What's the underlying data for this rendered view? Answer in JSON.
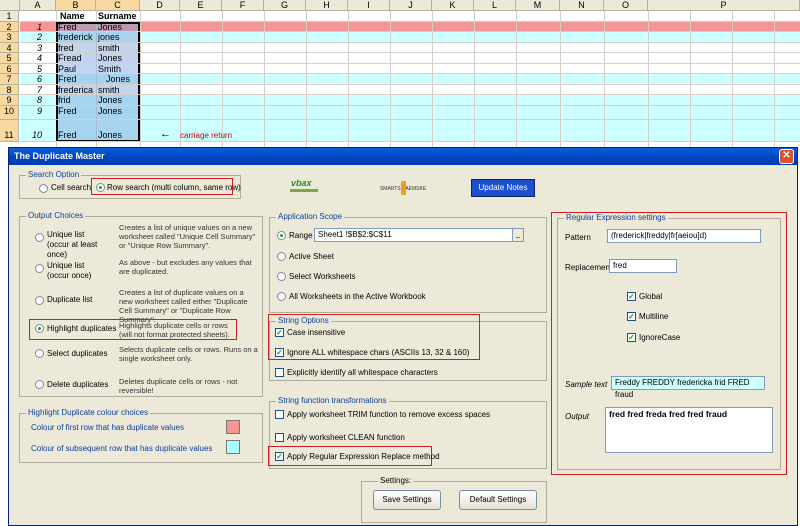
{
  "sheet": {
    "columns": [
      "A",
      "B",
      "C",
      "D",
      "E",
      "F",
      "G",
      "H",
      "I",
      "J",
      "K",
      "L",
      "M",
      "N",
      "O",
      "P"
    ],
    "header_row": {
      "b": "Name",
      "c": "Surname"
    },
    "rows": [
      {
        "r": "1",
        "a": "",
        "b": "Name",
        "c": "Surname"
      },
      {
        "r": "2",
        "a": "1",
        "b": "Fred",
        "c": "Jones"
      },
      {
        "r": "3",
        "a": "2",
        "b": "frederick",
        "c": "jones"
      },
      {
        "r": "4",
        "a": "3",
        "b": "fred",
        "c": "smith"
      },
      {
        "r": "5",
        "a": "4",
        "b": "Fread",
        "c": "Jones"
      },
      {
        "r": "6",
        "a": "5",
        "b": "Paul",
        "c": "Smith"
      },
      {
        "r": "7",
        "a": "6",
        "b": "Fred",
        "c": "Jones"
      },
      {
        "r": "8",
        "a": "7",
        "b": "frederica",
        "c": "smith"
      },
      {
        "r": "9",
        "a": "8",
        "b": "frid",
        "c": "Jones"
      },
      {
        "r": "10",
        "a": "9",
        "b": "Fred",
        "c": "Jones"
      },
      {
        "r": "11",
        "a": "10",
        "b": "Fred",
        "c": "Jones"
      }
    ],
    "annotation": "carriage return",
    "colors": {
      "highlight_first": "#f79494",
      "highlight_sub": "#ccffff",
      "selection": "#9ec5e8"
    }
  },
  "dialog": {
    "title": "The Duplicate Master",
    "close_icon": "close-icon",
    "search_option": {
      "title": "Search Option",
      "cell_search": "Cell search",
      "row_search": "Row search (multi column, same row)"
    },
    "logos": {
      "vbax": "vbax",
      "sponsor": "SMARTS KAEMSKE"
    },
    "update_notes": "Update Notes",
    "output_choices": {
      "title": "Output Choices",
      "items": [
        {
          "label": "Unique list\n(occur at least once)",
          "desc": "Creates a list of unique values on a new worksheet called \"Unique Cell Summary\" or \"Unique Row Summary\"."
        },
        {
          "label": "Unique list\n(occur once)",
          "desc": "As above - but excludes any values that are duplicated."
        },
        {
          "label": "Duplicate list",
          "desc": "Creates a list of duplicate values on a new worksheet called either \"Duplicate Cell Summary\" or \"Duplicate Row Summary\"."
        },
        {
          "label": "Highlight duplicates",
          "desc": "Highlights duplicate cells or rows (will not format protected sheets)."
        },
        {
          "label": "Select duplicates",
          "desc": "Selects duplicate cells or rows. Runs on a single worksheet only."
        },
        {
          "label": "Delete duplicates",
          "desc": "Deletes duplicate cells or rows - not reversible!"
        }
      ]
    },
    "highlight_colours": {
      "title": "Highlight Duplicate colour choices",
      "first": "Colour of first row that has duplicate values",
      "subsequent": "Colour of subsequent row that has duplicate values"
    },
    "application_scope": {
      "title": "Application Scope",
      "range_label": "Range",
      "range_value": "Sheet1 !$B$2:$C$11",
      "active_sheet": "Active Sheet",
      "select_worksheets": "Select Worksheets",
      "all_worksheets": "All Worksheets in the Active Workbook"
    },
    "string_options": {
      "title": "String Options",
      "case_insensitive": "Case insensitive",
      "ignore_whitespace": "Ignore ALL whitespace chars (ASCIIs 13, 32 & 160)",
      "explicit_whitespace": "Explicitly identify all whitespace characters"
    },
    "string_transforms": {
      "title": "String function transformations",
      "trim": "Apply worksheet TRIM function to remove excess spaces",
      "clean": "Apply worksheet CLEAN function",
      "regex": "Apply Regular Expression Replace method"
    },
    "settings": {
      "title": "Settings:",
      "save": "Save Settings",
      "default": "Default Settings"
    },
    "regex": {
      "title": "Regular Expression settings",
      "pattern_label": "Pattern",
      "pattern_value": "(frederick|freddy|fr[aeiou]d)",
      "replacement_label": "Replacement",
      "replacement_value": "fred",
      "global": "Global",
      "multiline": "Multiline",
      "ignorecase": "IgnoreCase",
      "sample_label": "Sample text",
      "sample_value": "Freddy FREDDY fredericka frid FRED fraud",
      "output_label": "Output",
      "output_value": "fred fred freda fred fred fraud"
    }
  }
}
